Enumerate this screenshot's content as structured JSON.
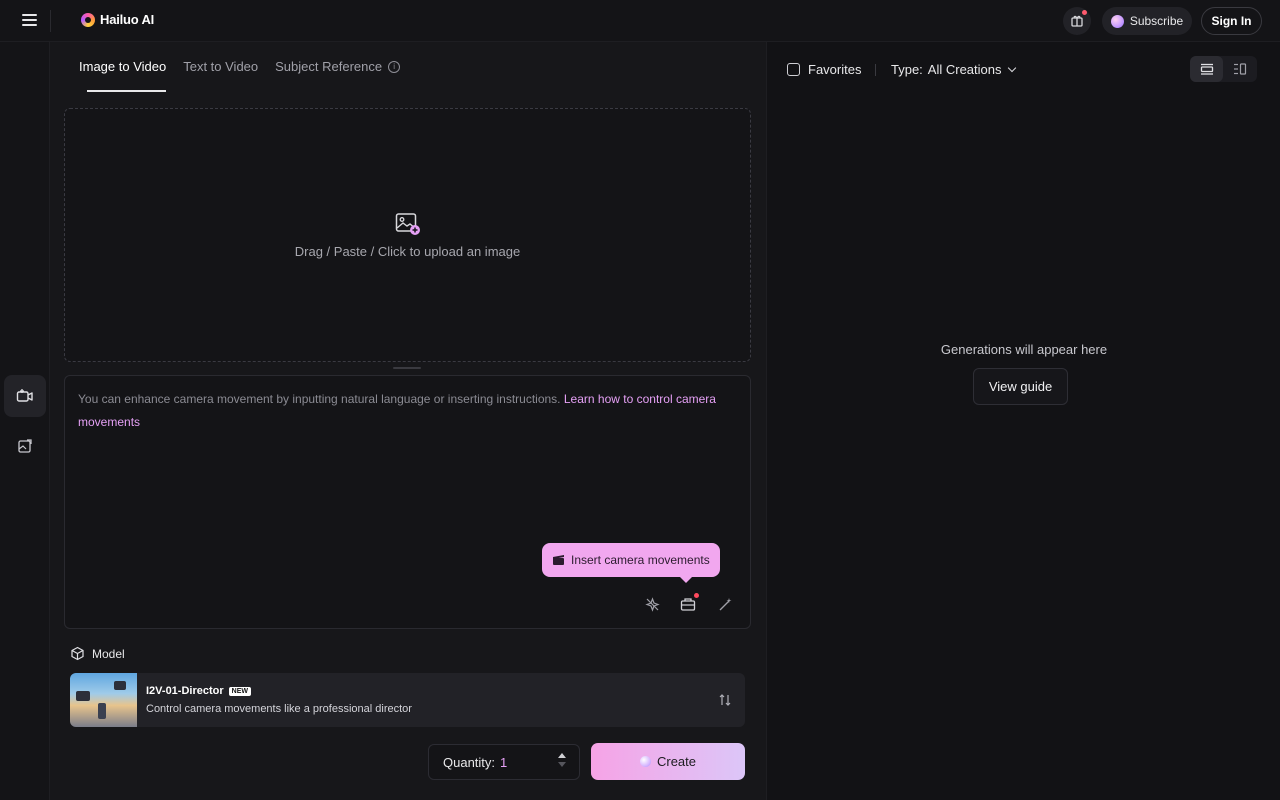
{
  "app": {
    "logo_text": "Hailuo AI"
  },
  "header": {
    "subscribe_label": "Subscribe",
    "signin_label": "Sign In"
  },
  "tabs": [
    {
      "label": "Image to Video",
      "active": true
    },
    {
      "label": "Text to Video",
      "active": false
    },
    {
      "label": "Subject Reference",
      "active": false
    }
  ],
  "upload": {
    "text": "Drag / Paste / Click to upload an image"
  },
  "prompt": {
    "placeholder": "You can enhance camera movement by inputting natural language or inserting instructions.",
    "link_text": "Learn how to control camera movements",
    "tooltip": "Insert camera movements"
  },
  "model": {
    "section_label": "Model",
    "name": "I2V-01-Director",
    "badge": "NEW",
    "description": "Control camera movements like a professional director"
  },
  "quantity": {
    "label": "Quantity:",
    "value": "1"
  },
  "create_label": "Create",
  "gallery": {
    "favorites_label": "Favorites",
    "type_label": "Type:",
    "type_value": "All Creations",
    "empty_text": "Generations will appear here",
    "guide_label": "View guide"
  },
  "colors": {
    "accent": "#f1a7ef",
    "link": "#e5a0f5",
    "background": "#121215"
  }
}
